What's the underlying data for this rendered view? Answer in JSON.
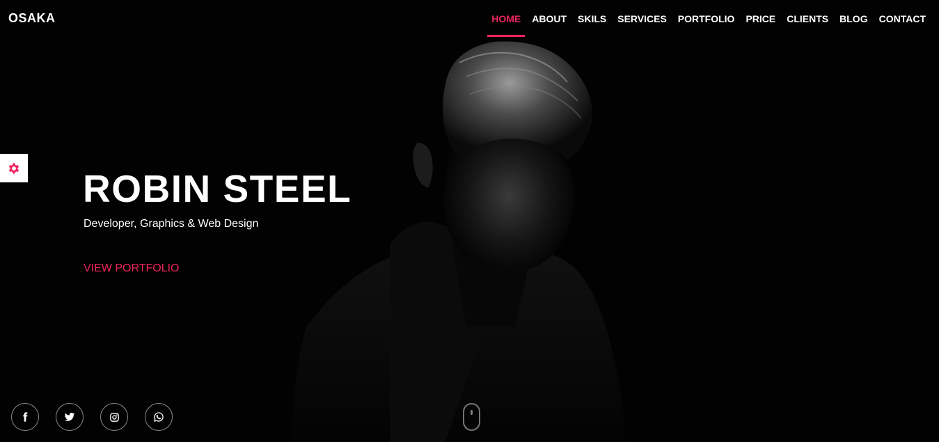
{
  "brand": "OSAKA",
  "nav": {
    "items": [
      {
        "label": "HOME",
        "active": true
      },
      {
        "label": "ABOUT"
      },
      {
        "label": "SKILS"
      },
      {
        "label": "SERVICES"
      },
      {
        "label": "PORTFOLIO"
      },
      {
        "label": "PRICE"
      },
      {
        "label": "CLIENTS"
      },
      {
        "label": "BLOG"
      },
      {
        "label": "CONTACT"
      }
    ]
  },
  "hero": {
    "title": "ROBIN STEEL",
    "subtitle": "Developer, Graphics & Web Design",
    "cta": "VIEW PORTFOLIO"
  },
  "settings": {
    "icon": "gear-icon"
  },
  "socials": [
    {
      "icon": "facebook-icon"
    },
    {
      "icon": "twitter-icon"
    },
    {
      "icon": "instagram-icon"
    },
    {
      "icon": "whatsapp-icon"
    }
  ],
  "scroll": {
    "icon": "mouse-scroll-icon"
  },
  "colors": {
    "accent": "#f0245f",
    "background": "#000000",
    "text": "#ffffff"
  }
}
